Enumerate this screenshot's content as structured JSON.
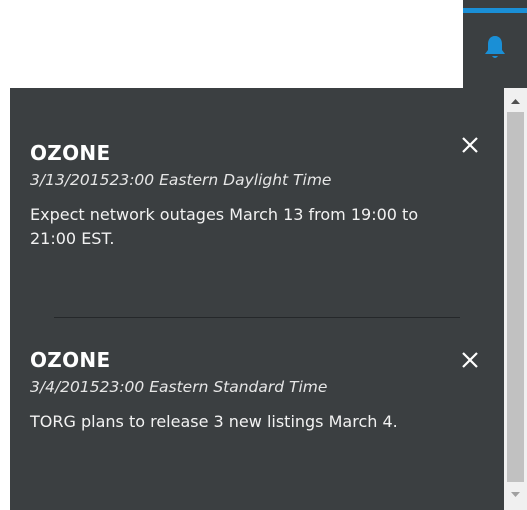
{
  "bell": {
    "icon": "bell-icon",
    "accent_color": "#1a8fd6"
  },
  "notifications": [
    {
      "title": "OZONE",
      "date": "3/13/201523:00 Eastern Daylight Time",
      "message": "Expect network outages March 13 from 19:00 to 21:00 EST.",
      "close_icon": "close-icon"
    },
    {
      "title": "OZONE",
      "date": "3/4/201523:00 Eastern Standard Time",
      "message": "TORG plans to release 3 new listings March  4.",
      "close_icon": "close-icon"
    }
  ],
  "colors": {
    "panel_background": "#3b3f41",
    "text": "#ffffff",
    "scrollbar_track": "#f0f0f0",
    "scrollbar_thumb": "#c1c1c1"
  }
}
